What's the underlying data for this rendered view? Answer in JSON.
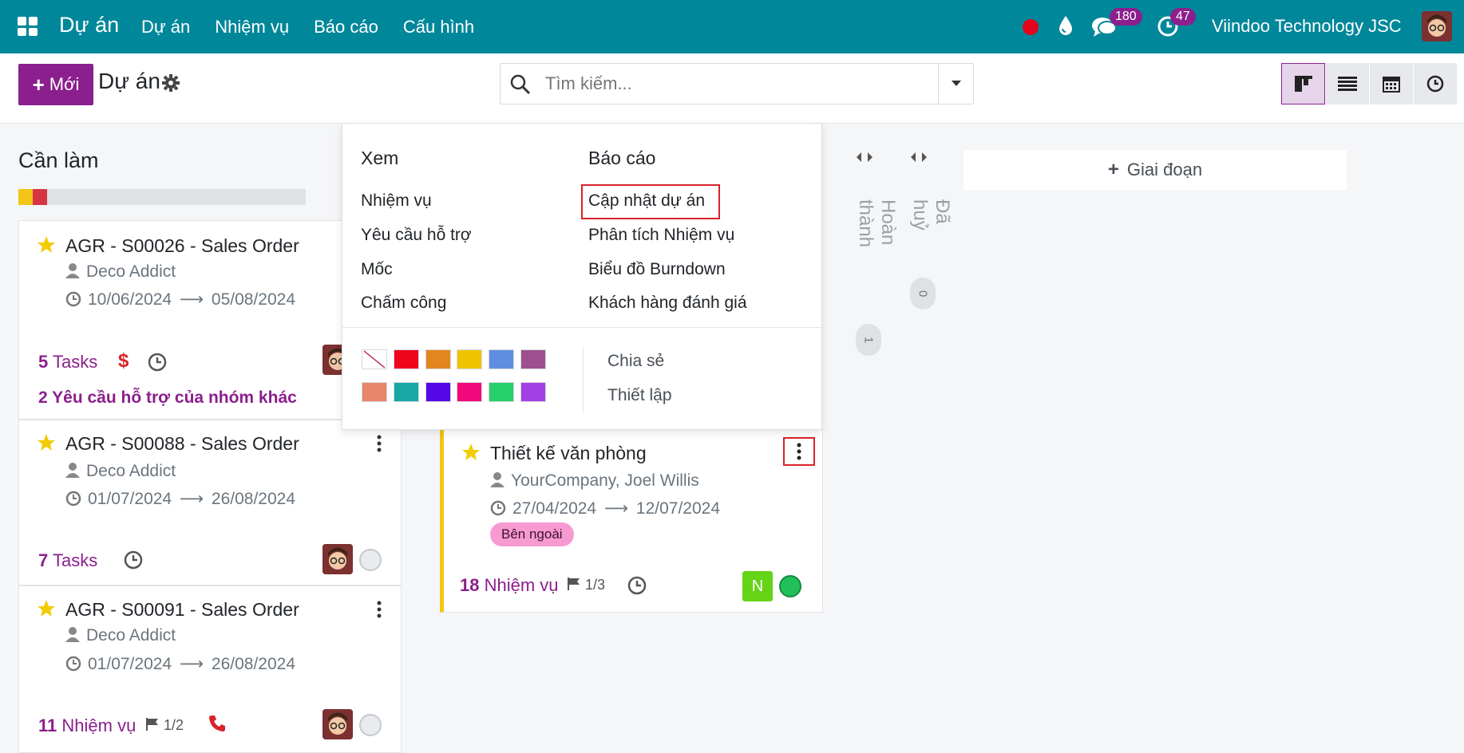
{
  "navbar": {
    "brand": "Dự án",
    "menu": [
      "Dự án",
      "Nhiệm vụ",
      "Báo cáo",
      "Cấu hình"
    ],
    "chat_count": "180",
    "activity_count": "47",
    "company": "Viindoo Technology JSC"
  },
  "control": {
    "new_label": "Mới",
    "title": "Dự án",
    "search_placeholder": "Tìm kiếm..."
  },
  "column": {
    "title": "Cần làm"
  },
  "cards": [
    {
      "title": "AGR - S00026 - Sales Order",
      "customer": "Deco Addict",
      "date_start": "10/06/2024",
      "date_end": "05/08/2024",
      "task_num": "5",
      "task_label": "Tasks",
      "extra": "2 Yêu cầu hỗ trợ của nhóm khác"
    },
    {
      "title": "AGR - S00088 - Sales Order",
      "customer": "Deco Addict",
      "date_start": "01/07/2024",
      "date_end": "26/08/2024",
      "task_num": "7",
      "task_label": "Tasks"
    },
    {
      "title": "AGR - S00091 - Sales Order",
      "customer": "Deco Addict",
      "date_start": "01/07/2024",
      "date_end": "26/08/2024",
      "task_num": "11",
      "task_label": "Nhiệm vụ",
      "milestone": "1/2"
    }
  ],
  "selected_card": {
    "title": "Thiết kế văn phòng",
    "customer": "YourCompany, Joel Willis",
    "date_start": "27/04/2024",
    "date_end": "12/07/2024",
    "tag": "Bên ngoài",
    "task_num": "18",
    "task_label": "Nhiệm vụ",
    "milestone": "1/3",
    "avatar_letter": "N"
  },
  "folded": [
    {
      "label": "Hoàn thành",
      "count": "1"
    },
    {
      "label": "Đã huỷ",
      "count": "0"
    }
  ],
  "add_stage": "Giai đoạn",
  "dropdown": {
    "view_header": "Xem",
    "view_items": [
      "Nhiệm vụ",
      "Yêu cầu hỗ trợ",
      "Mốc",
      "Chấm công"
    ],
    "report_header": "Báo cáo",
    "report_items": [
      "Cập nhật dự án",
      "Phân tích Nhiệm vụ",
      "Biểu đồ Burndown",
      "Khách hàng đánh giá"
    ],
    "actions": [
      "Chia sẻ",
      "Thiết lập"
    ],
    "colors": [
      "none",
      "#f0061b",
      "#e4861f",
      "#eec400",
      "#5f8ee0",
      "#9e4f8f",
      "#e8866b",
      "#18a8a4",
      "#5408e8",
      "#f2097b",
      "#27cf6a",
      "#a240e4"
    ]
  }
}
